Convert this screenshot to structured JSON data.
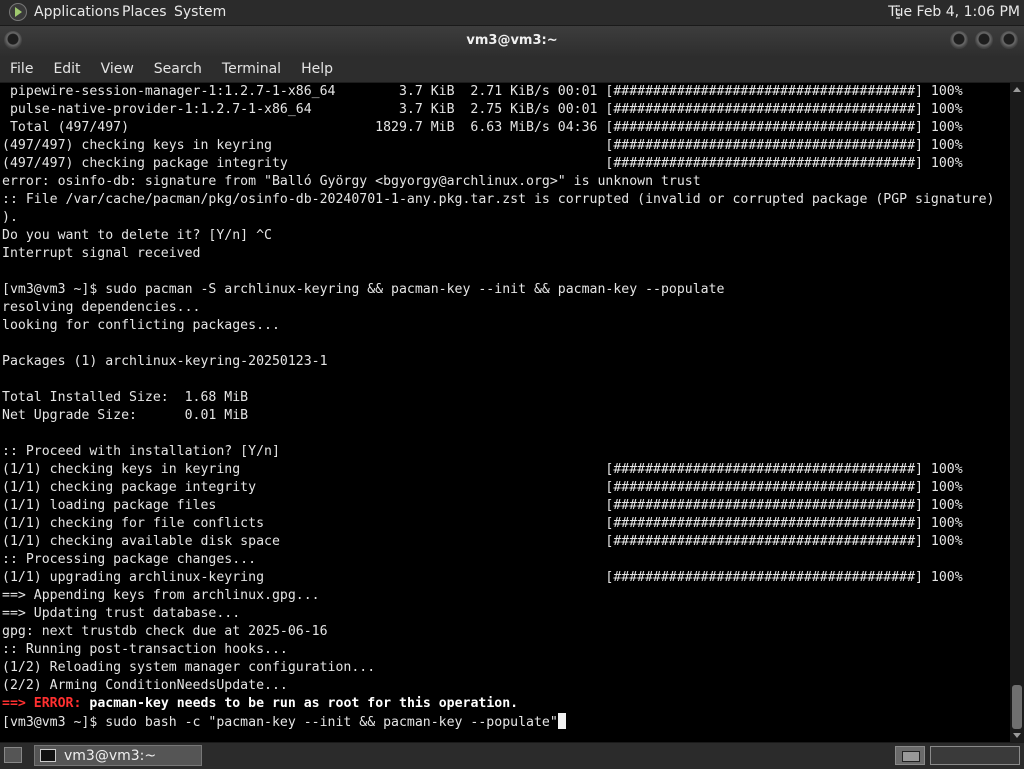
{
  "top_panel": {
    "menus": [
      "Applications",
      "Places",
      "System"
    ],
    "clock": "Tue Feb  4,  1:06 PM"
  },
  "window": {
    "title": "vm3@vm3:~"
  },
  "menubar": [
    "File",
    "Edit",
    "View",
    "Search",
    "Terminal",
    "Help"
  ],
  "terminal": {
    "lines": [
      " pipewire-session-manager-1:1.2.7-1-x86_64        3.7 KiB  2.71 KiB/s 00:01 [######################################] 100%",
      " pulse-native-provider-1:1.2.7-1-x86_64           3.7 KiB  2.75 KiB/s 00:01 [######################################] 100%",
      " Total (497/497)                               1829.7 MiB  6.63 MiB/s 04:36 [######################################] 100%",
      "(497/497) checking keys in keyring                                          [######################################] 100%",
      "(497/497) checking package integrity                                        [######################################] 100%",
      "error: osinfo-db: signature from \"Balló György <bgyorgy@archlinux.org>\" is unknown trust",
      ":: File /var/cache/pacman/pkg/osinfo-db-20240701-1-any.pkg.tar.zst is corrupted (invalid or corrupted package (PGP signature)",
      ").",
      "Do you want to delete it? [Y/n] ^C",
      "Interrupt signal received",
      "",
      "[vm3@vm3 ~]$ sudo pacman -S archlinux-keyring && pacman-key --init && pacman-key --populate",
      "resolving dependencies...",
      "looking for conflicting packages...",
      "",
      "Packages (1) archlinux-keyring-20250123-1",
      "",
      "Total Installed Size:  1.68 MiB",
      "Net Upgrade Size:      0.01 MiB",
      "",
      ":: Proceed with installation? [Y/n]",
      "(1/1) checking keys in keyring                                              [######################################] 100%",
      "(1/1) checking package integrity                                            [######################################] 100%",
      "(1/1) loading package files                                                 [######################################] 100%",
      "(1/1) checking for file conflicts                                           [######################################] 100%",
      "(1/1) checking available disk space                                         [######################################] 100%",
      ":: Processing package changes...",
      "(1/1) upgrading archlinux-keyring                                           [######################################] 100%",
      "==> Appending keys from archlinux.gpg...",
      "==> Updating trust database...",
      "gpg: next trustdb check due at 2025-06-16",
      ":: Running post-transaction hooks...",
      "(1/2) Reloading system manager configuration...",
      "(2/2) Arming ConditionNeedsUpdate..."
    ],
    "error_line": {
      "arrow": "==>",
      "label": "ERROR:",
      "message": "pacman-key needs to be run as root for this operation."
    },
    "prompt": "[vm3@vm3 ~]$ sudo bash -c \"pacman-key --init && pacman-key --populate\""
  },
  "taskbar": {
    "task_label": "vm3@vm3:~"
  }
}
